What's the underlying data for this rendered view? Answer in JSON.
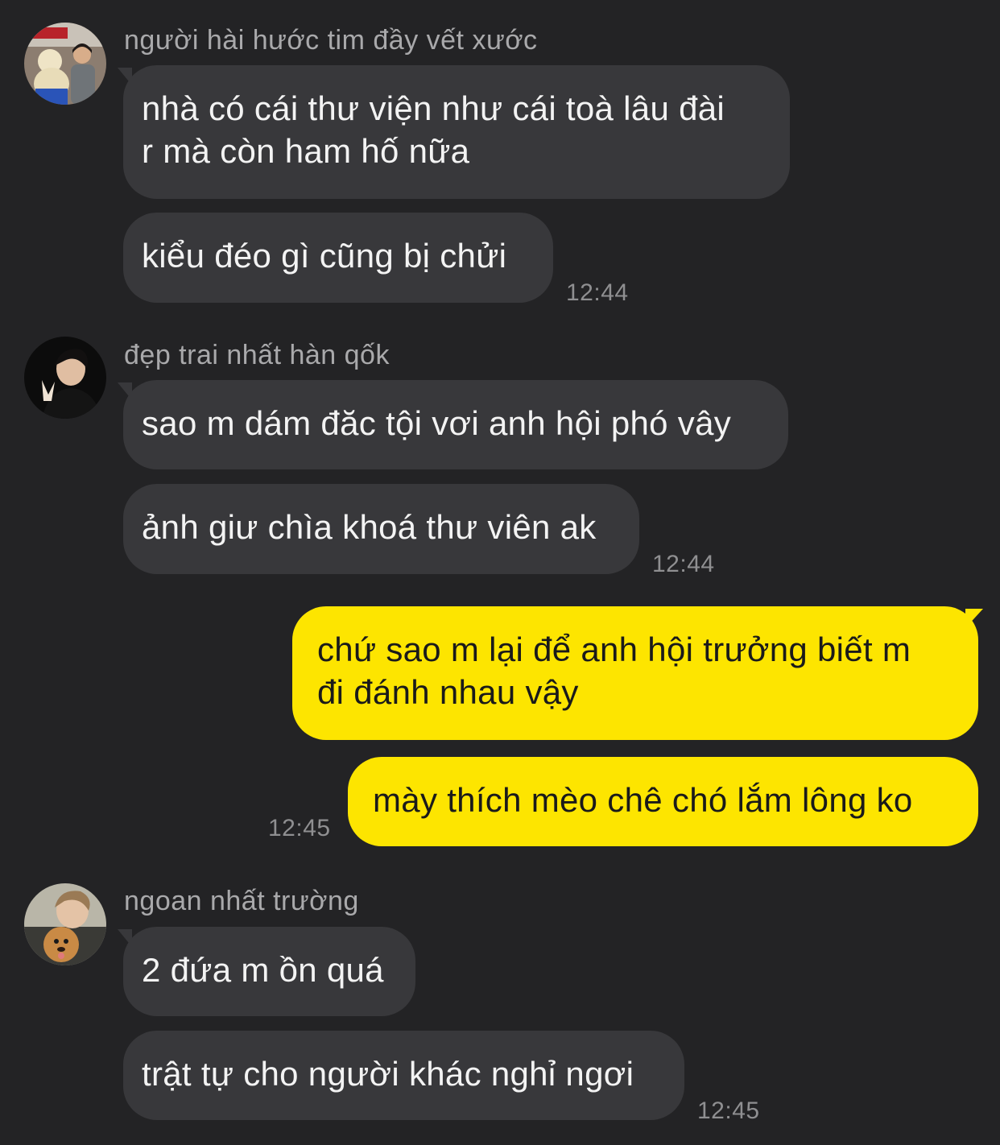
{
  "chat": {
    "groups": [
      {
        "sender": "người hài hước tim đầy vết xước",
        "avatar_icon": "user-avatar-icon",
        "messages": [
          "nhà có cái thư viện như cái toà lâu đài\nr mà còn ham hố nữa",
          "kiểu đéo gì cũng bị chửi"
        ],
        "time": "12:44"
      },
      {
        "sender": "đẹp trai nhất hàn qốk",
        "avatar_icon": "user-avatar-icon",
        "messages": [
          "sao m dám đăc tội vơi anh hội phó vây",
          "ảnh giư chìa khoá thư viên ak"
        ],
        "time": "12:44"
      },
      {
        "sender": "ngoan nhất trường",
        "avatar_icon": "user-avatar-icon",
        "messages": [
          "2 đứa m ồn quá",
          "trật tự cho người khác nghỉ ngơi"
        ],
        "time": "12:45"
      }
    ],
    "outgoing": {
      "messages": [
        "chứ sao m lại để anh hội trưởng biết m\nđi đánh nhau vậy",
        "mày thích mèo chê chó lắm lông ko"
      ],
      "time": "12:45"
    }
  },
  "colors": {
    "background": "#232325",
    "incoming_bubble": "#38383b",
    "outgoing_bubble": "#fde500",
    "incoming_text": "#f3f3f3",
    "outgoing_text": "#1a1a1a",
    "sender_name": "#a9a9ab",
    "timestamp": "#8f8f91"
  }
}
